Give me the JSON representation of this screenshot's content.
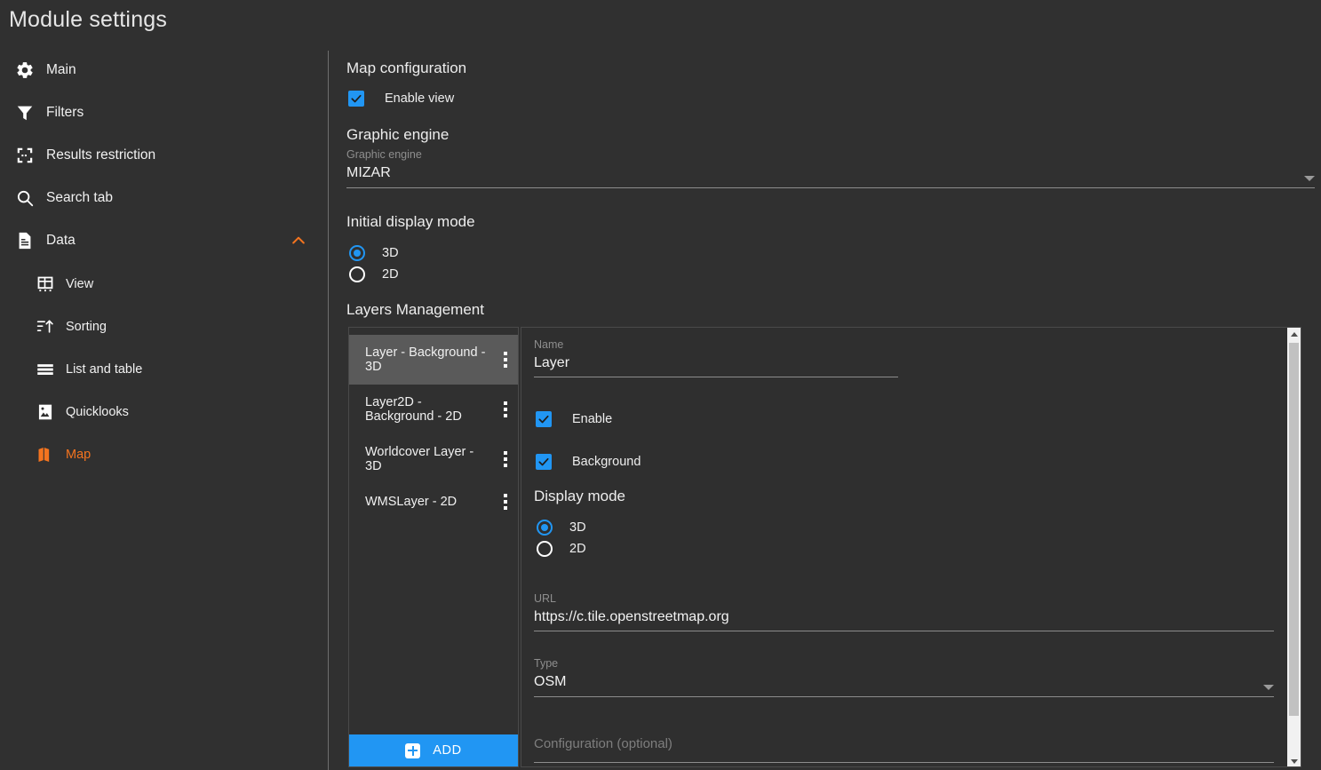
{
  "page_title": "Module settings",
  "colors": {
    "background": "#303030",
    "accent_orange": "#f4741f",
    "accent_blue": "#2196f3",
    "selected_row": "#5a5a5a"
  },
  "sidebar": {
    "items": [
      {
        "label": "Main",
        "icon": "gear-icon",
        "active": false
      },
      {
        "label": "Filters",
        "icon": "filter-icon",
        "active": false
      },
      {
        "label": "Results restriction",
        "icon": "crop-frame-icon",
        "active": false
      },
      {
        "label": "Search tab",
        "icon": "search-icon",
        "active": false
      },
      {
        "label": "Data",
        "icon": "document-icon",
        "active": false,
        "expanded": true,
        "chevron": "chevron-up-icon"
      }
    ],
    "sub_items": [
      {
        "label": "View",
        "icon": "table-view-icon",
        "active": false
      },
      {
        "label": "Sorting",
        "icon": "sort-icon",
        "active": false
      },
      {
        "label": "List and table",
        "icon": "list-icon",
        "active": false
      },
      {
        "label": "Quicklooks",
        "icon": "image-icon",
        "active": false
      },
      {
        "label": "Map",
        "icon": "map-icon",
        "active": true
      }
    ]
  },
  "main": {
    "map_configuration": {
      "title": "Map configuration",
      "enable_view_label": "Enable view",
      "enable_view_checked": true
    },
    "graphic_engine": {
      "title": "Graphic engine",
      "field_label": "Graphic engine",
      "value": "MIZAR",
      "options": [
        "MIZAR"
      ]
    },
    "initial_display_mode": {
      "title": "Initial display mode",
      "options": [
        {
          "label": "3D",
          "selected": true
        },
        {
          "label": "2D",
          "selected": false
        }
      ]
    },
    "layers_management": {
      "title": "Layers Management",
      "add_button_label": "ADD",
      "layers": [
        {
          "name": "Layer - Background - 3D",
          "selected": true
        },
        {
          "name": "Layer2D - Background - 2D",
          "selected": false
        },
        {
          "name": "Worldcover Layer - 3D",
          "selected": false
        },
        {
          "name": "WMSLayer - 2D",
          "selected": false
        }
      ],
      "detail": {
        "name_label": "Name",
        "name_value": "Layer",
        "enable_label": "Enable",
        "enable_checked": true,
        "background_label": "Background",
        "background_checked": true,
        "display_mode_title": "Display mode",
        "display_mode_options": [
          {
            "label": "3D",
            "selected": true
          },
          {
            "label": "2D",
            "selected": false
          }
        ],
        "url_label": "URL",
        "url_value": "https://c.tile.openstreetmap.org",
        "type_label": "Type",
        "type_value": "OSM",
        "type_options": [
          "OSM"
        ],
        "configuration_label": "Configuration (optional)",
        "configuration_value": ""
      }
    }
  }
}
